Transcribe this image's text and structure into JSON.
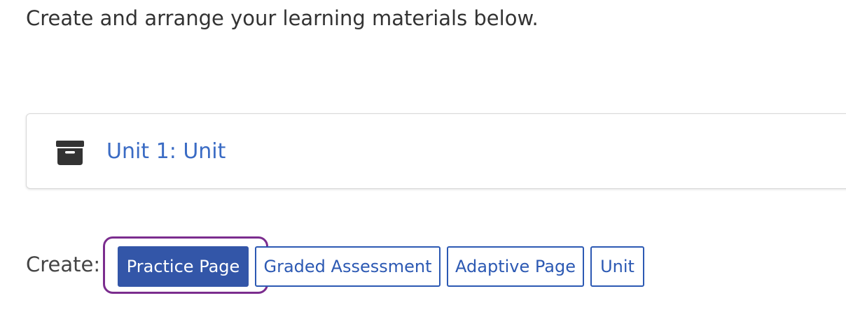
{
  "intro_text": "Create and arrange your learning materials below.",
  "unit_card": {
    "icon": "archive-box-icon",
    "title": "Unit 1: Unit"
  },
  "create_bar": {
    "label": "Create:",
    "buttons": [
      {
        "label": "Practice Page",
        "style": "primary",
        "highlighted": true
      },
      {
        "label": "Graded Assessment",
        "style": "outline"
      },
      {
        "label": "Adaptive Page",
        "style": "outline"
      },
      {
        "label": "Unit",
        "style": "outline"
      }
    ]
  },
  "colors": {
    "link": "#3a6bc4",
    "primary_button": "#3356a8",
    "outline_button": "#2c59b3",
    "highlight_ring": "#7b2d8e",
    "icon": "#333333"
  }
}
